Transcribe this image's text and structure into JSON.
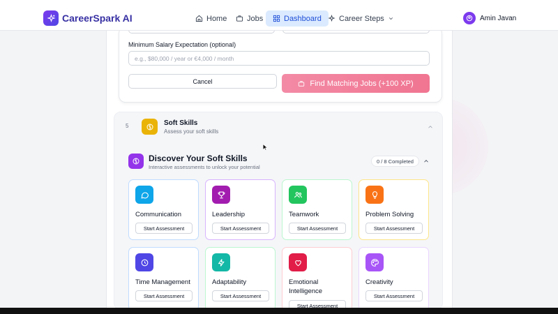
{
  "brand": {
    "name": "CareerSpark AI"
  },
  "nav": {
    "items": [
      {
        "label": "Home",
        "icon": "home-icon"
      },
      {
        "label": "Jobs",
        "icon": "briefcase-icon"
      },
      {
        "label": "Dashboard",
        "icon": "grid-icon",
        "active": true
      },
      {
        "label": "Career Steps",
        "icon": "sparkle-icon"
      }
    ]
  },
  "user": {
    "name": "Amin Javan"
  },
  "form": {
    "salary_label": "Minimum Salary Expectation (optional)",
    "salary_placeholder": "e.g., $80,000 / year or €4,000 / month",
    "cancel_label": "Cancel",
    "find_label": "Find Matching Jobs (+100 XP)"
  },
  "soft_skills": {
    "step": "5",
    "title": "Soft Skills",
    "subtitle": "Assess your soft skills",
    "discover_title": "Discover Your Soft Skills",
    "discover_subtitle": "Interactive assessments to unlock your potential",
    "progress": "0 / 8 Completed",
    "start_label": "Start Assessment",
    "cards": [
      {
        "name": "Communication",
        "icon": "chat-bubble-icon",
        "color": "#0ea5e9",
        "border": "#bfdbfe"
      },
      {
        "name": "Leadership",
        "icon": "trophy-icon",
        "color": "#a21caf",
        "border": "#d8b4fe"
      },
      {
        "name": "Teamwork",
        "icon": "users-icon",
        "color": "#22c55e",
        "border": "#bbf7d0"
      },
      {
        "name": "Problem Solving",
        "icon": "lightbulb-icon",
        "color": "#f97316",
        "border": "#fde68a"
      },
      {
        "name": "Time Management",
        "icon": "clock-icon",
        "color": "#4f46e5",
        "border": "#bfdbfe"
      },
      {
        "name": "Adaptability",
        "icon": "bolt-icon",
        "color": "#14b8a6",
        "border": "#bbf7d0"
      },
      {
        "name": "Emotional Intelligence",
        "icon": "heart-icon",
        "color": "#e11d48",
        "border": "#fecdd3"
      },
      {
        "name": "Creativity",
        "icon": "palette-icon",
        "color": "#a855f7",
        "border": "#e9d5ff"
      }
    ]
  }
}
